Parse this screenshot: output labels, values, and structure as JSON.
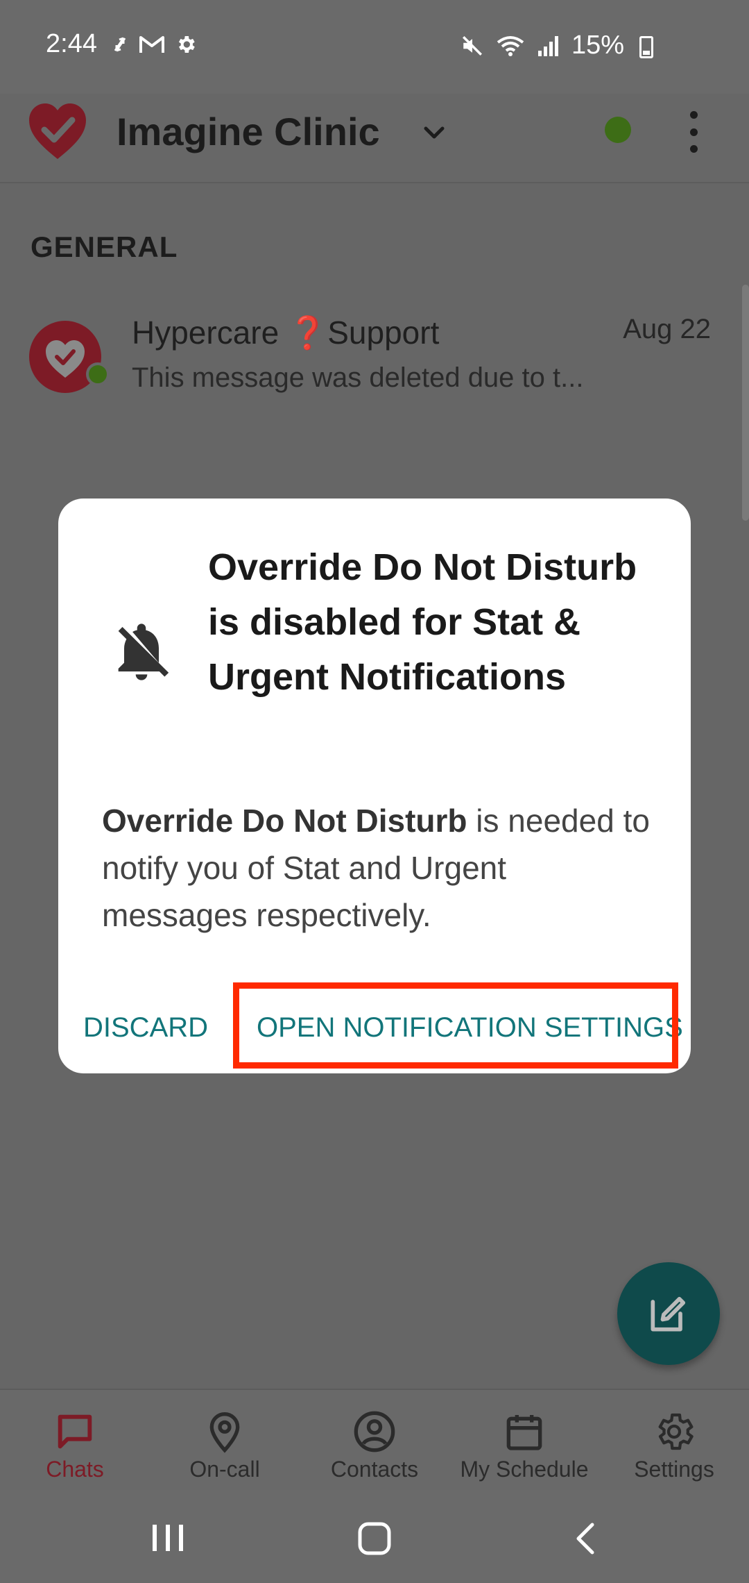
{
  "status_bar": {
    "time": "2:44",
    "battery": "15%"
  },
  "app_bar": {
    "title": "Imagine Clinic",
    "online_color": "#3d6d16"
  },
  "chat_list": {
    "section": "GENERAL",
    "chats": [
      {
        "name": "Hypercare ❓Support",
        "date": "Aug 22",
        "preview": "This message was deleted due to t..."
      }
    ]
  },
  "dialog": {
    "title": "Override Do Not Disturb is disabled for Stat & Urgent Notifications",
    "body_bold": "Override Do Not Disturb",
    "body_rest": " is needed to notify you of Stat and Urgent messages respectively.",
    "discard_label": "DISCARD",
    "open_label": "OPEN NOTIFICATION SETTINGS",
    "icon": "bell-off-icon"
  },
  "bottom_nav": {
    "items": [
      {
        "label": "Chats",
        "icon": "chat-icon",
        "active": true
      },
      {
        "label": "On-call",
        "icon": "location-pin-icon",
        "active": false
      },
      {
        "label": "Contacts",
        "icon": "person-circle-icon",
        "active": false
      },
      {
        "label": "My Schedule",
        "icon": "calendar-icon",
        "active": false
      },
      {
        "label": "Settings",
        "icon": "gear-icon",
        "active": false
      }
    ]
  },
  "colors": {
    "brand": "#7d1b26",
    "accent": "#12757a",
    "highlight": "#ff2a00"
  }
}
